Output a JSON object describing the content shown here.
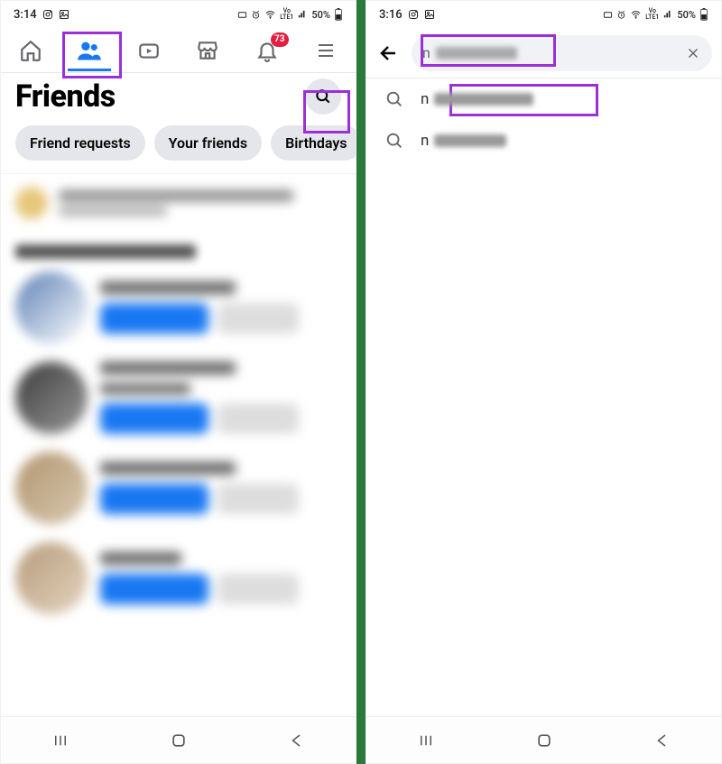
{
  "left": {
    "status": {
      "time": "3:14",
      "battery": "50%",
      "net": "LTE1",
      "vo": "Vo"
    },
    "tabs": {
      "notif_badge": "73"
    },
    "title": "Friends",
    "chips": [
      "Friend requests",
      "Your friends",
      "Birthdays"
    ]
  },
  "right": {
    "status": {
      "time": "3:16",
      "battery": "50%",
      "net": "LTE1",
      "vo": "Vo"
    },
    "search": {
      "prefix": "n"
    },
    "suggest": [
      {
        "prefix": "n"
      },
      {
        "prefix": "n"
      }
    ]
  }
}
